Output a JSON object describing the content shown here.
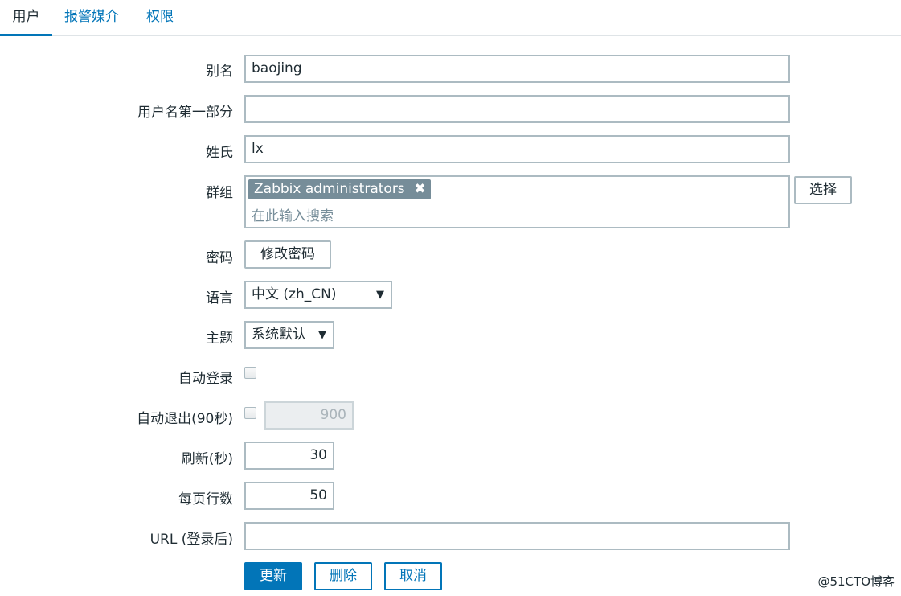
{
  "tabs": [
    "用户",
    "报警媒介",
    "权限"
  ],
  "form": {
    "alias": {
      "label": "别名",
      "value": "baojing"
    },
    "name": {
      "label": "用户名第一部分",
      "value": ""
    },
    "surname": {
      "label": "姓氏",
      "value": "lx"
    },
    "groups": {
      "label": "群组",
      "chip": "Zabbix administrators",
      "chip_remove": "✖",
      "placeholder": "在此输入搜索",
      "select_button": "选择"
    },
    "password": {
      "label": "密码",
      "button": "修改密码"
    },
    "language": {
      "label": "语言",
      "value": "中文 (zh_CN)",
      "caret": "▼"
    },
    "theme": {
      "label": "主题",
      "value": "系统默认",
      "caret": "▼"
    },
    "autologin": {
      "label": "自动登录",
      "checked": false
    },
    "autologout": {
      "label": "自动退出(90秒)",
      "checked": false,
      "value": "900"
    },
    "refresh": {
      "label": "刷新(秒)",
      "value": "30"
    },
    "rows_per_page": {
      "label": "每页行数",
      "value": "50"
    },
    "url": {
      "label": "URL (登录后)",
      "value": ""
    }
  },
  "actions": {
    "update": "更新",
    "delete": "删除",
    "cancel": "取消"
  },
  "watermark": "@51CTO博客",
  "colors": {
    "accent": "#0275b8",
    "chip": "#768d99"
  }
}
